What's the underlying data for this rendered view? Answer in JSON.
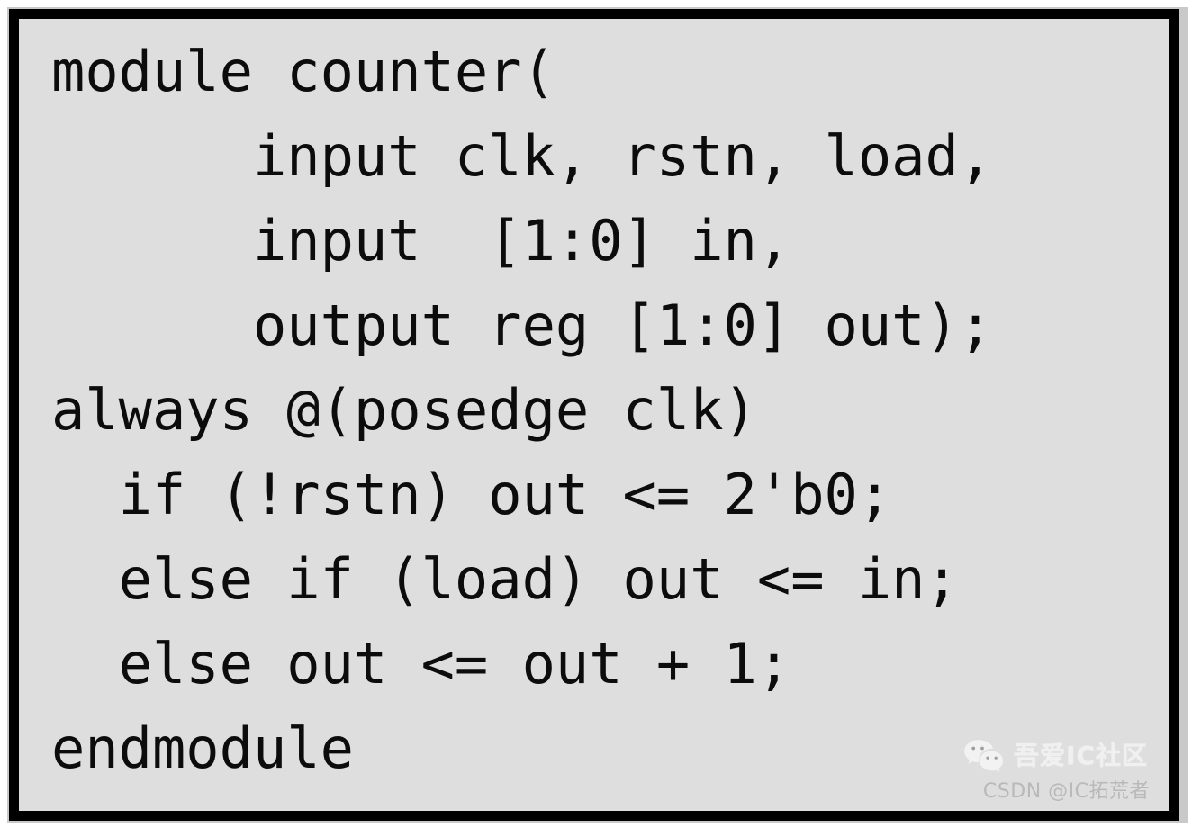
{
  "document": {
    "kind": "code-snippet-image",
    "language": "Verilog",
    "module_name": "counter",
    "background_color": "#dedede",
    "border_color": "#000000",
    "text_color": "#0c0c0c"
  },
  "code": {
    "lines": [
      "module counter(",
      "      input clk, rstn, load,",
      "      input  [1:0] in,",
      "      output reg [1:0] out);",
      "always @(posedge clk)",
      "  if (!rstn) out <= 2'b0;",
      "  else if (load) out <= in;",
      "  else out <= out + 1;",
      "endmodule"
    ],
    "full_text": "module counter(\n      input clk, rstn, load,\n      input  [1:0] in,\n      output reg [1:0] out);\nalways @(posedge clk)\n  if (!rstn) out <= 2'b0;\n  else if (load) out <= in;\n  else out <= out + 1;\nendmodule"
  },
  "watermark": {
    "icon_name": "wechat-icon",
    "brand_text": "吾爱IC社区",
    "brand_color": "#f2f2f2"
  },
  "credit": {
    "text": "CSDN @IC拓荒者",
    "color": "#b9b9b9"
  }
}
